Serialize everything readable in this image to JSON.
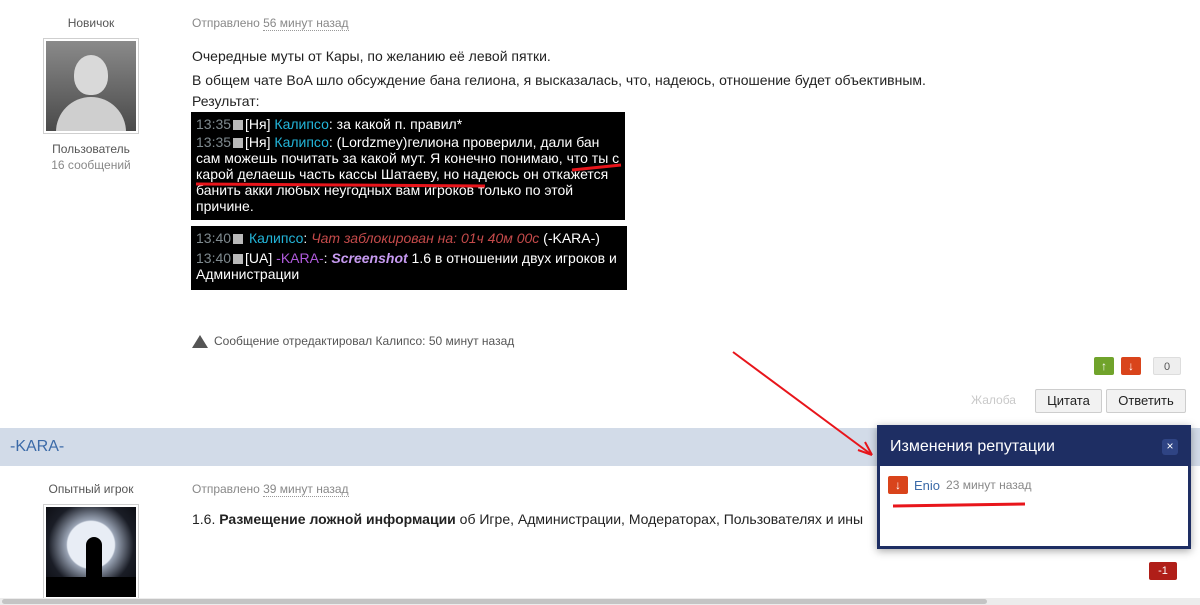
{
  "post1": {
    "rank": "Новичок",
    "group": "Пользователь",
    "post_count": "16 сообщений",
    "posted_prefix": "Отправлено",
    "posted_time": "56 минут назад",
    "lines": [
      "Очередные муты от Кары, по желанию её левой пятки.",
      "В общем чате BoA шло обсуждение бана гелиона, я высказалась, что, надеюсь, отношение будет объективным.",
      "Результат:"
    ],
    "chat1": {
      "l1_time": "13:35",
      "l1_tag": "[Ня]",
      "l1_name": "Калипсо",
      "l1_text": ": за какой п. правил*",
      "l2_time": "13:35",
      "l2_tag": "[Ня]",
      "l2_name": "Калипсо",
      "l2_text": ": (Lordzmey)гелиона проверили, дали бан сам можешь почитать за какой мут. Я конечно понимаю, что ты с карой делаешь часть кассы Шатаеву, но надеюсь он откажется банить акки любых неугодных вам игроков только по этой причине."
    },
    "chat2": {
      "l1_time": "13:40",
      "l1_name": "Калипсо",
      "l1_sep": ": ",
      "l1_blocked": "Чат заблокирован на: 01ч 40м 00с",
      "l1_by": " (-KARA-)",
      "l2_time": "13:40",
      "l2_tag": "[UA]",
      "l2_name": "-KARA-",
      "l2_sep": ": ",
      "l2_shot": "Screenshot",
      "l2_text": " 1.6 в отношении двух игроков и Администрации"
    },
    "edit_note": "Сообщение отредактировал Калипсо: 50 минут назад",
    "rep_up": "↑",
    "rep_down": "↓",
    "rep_count": "0",
    "report": "Жалоба",
    "quote_btn": "Цитата",
    "reply_btn": "Ответить"
  },
  "post2": {
    "author": "-KARA-",
    "rank": "Опытный игрок",
    "posted_prefix": "Отправлено",
    "posted_time": "39 минут назад",
    "rule_num": "1.6.",
    "rule_bold": "Размещение ложной информации",
    "rule_text": " об Игре, Администрации, Модераторах, Пользователях и ины",
    "rep_badge": "-1"
  },
  "popup": {
    "title": "Изменения репутации",
    "close": "×",
    "down": "↓",
    "user": "Enio",
    "time": "23 минут назад"
  },
  "colors": {
    "annotation_red": "#e8151b",
    "popup_header": "#1e2e63",
    "author_bar": "#d2dbe8"
  }
}
